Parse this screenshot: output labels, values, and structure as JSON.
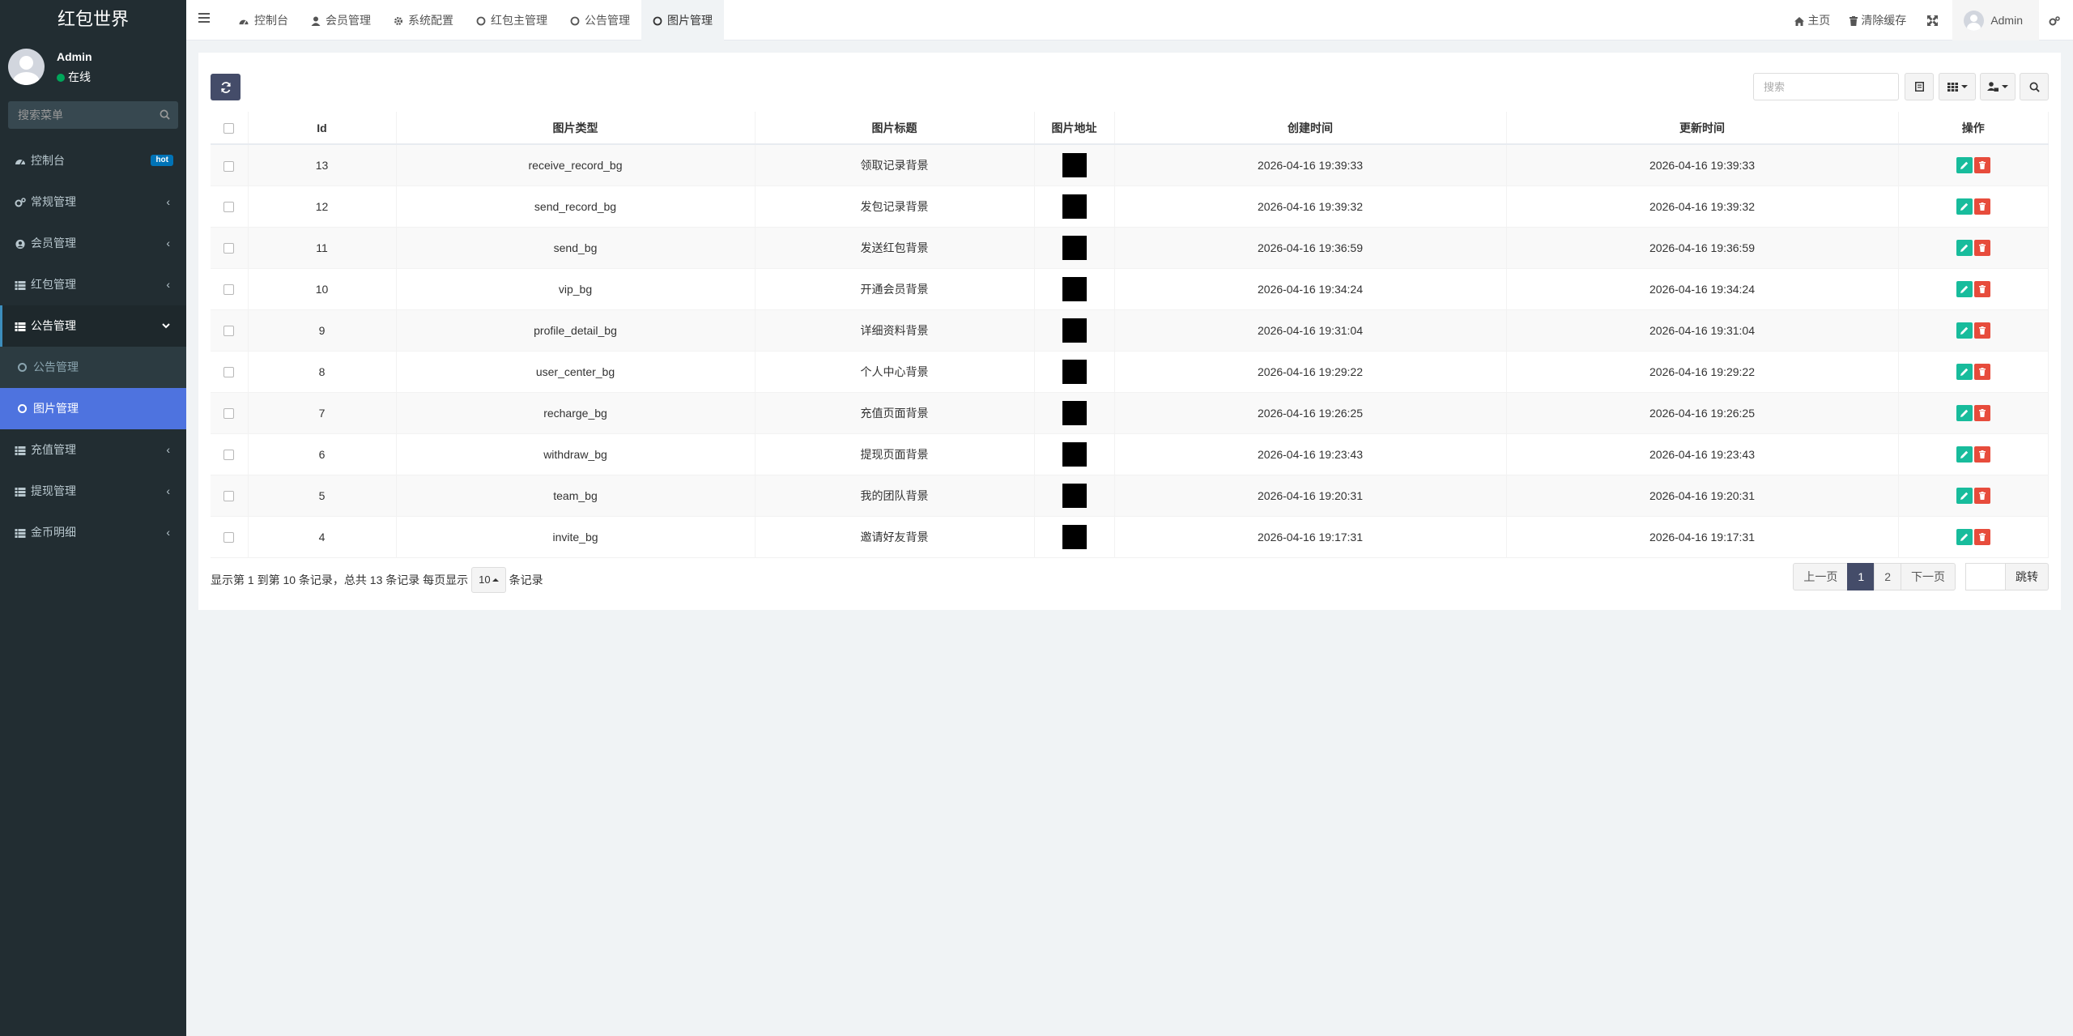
{
  "app": {
    "title": "红包世界"
  },
  "user": {
    "name": "Admin",
    "status": "在线"
  },
  "sidebar": {
    "search_placeholder": "搜索菜单",
    "items": [
      {
        "label": "控制台",
        "badge": "hot"
      },
      {
        "label": "常规管理"
      },
      {
        "label": "会员管理"
      },
      {
        "label": "红包管理"
      },
      {
        "label": "公告管理"
      },
      {
        "label": "公告管理"
      },
      {
        "label": "图片管理"
      },
      {
        "label": "充值管理"
      },
      {
        "label": "提现管理"
      },
      {
        "label": "金币明细"
      }
    ]
  },
  "header": {
    "tabs": [
      "控制台",
      "会员管理",
      "系统配置",
      "红包主管理",
      "公告管理",
      "图片管理"
    ],
    "home": "主页",
    "clear_cache": "清除缓存",
    "user": "Admin"
  },
  "toolbar": {
    "search_placeholder": "搜索"
  },
  "table": {
    "columns": [
      "Id",
      "图片类型",
      "图片标题",
      "图片地址",
      "创建时间",
      "更新时间",
      "操作"
    ],
    "rows": [
      {
        "id": "13",
        "type": "receive_record_bg",
        "title": "领取记录背景",
        "created": "2026-04-16 19:39:33",
        "updated": "2026-04-16 19:39:33"
      },
      {
        "id": "12",
        "type": "send_record_bg",
        "title": "发包记录背景",
        "created": "2026-04-16 19:39:32",
        "updated": "2026-04-16 19:39:32"
      },
      {
        "id": "11",
        "type": "send_bg",
        "title": "发送红包背景",
        "created": "2026-04-16 19:36:59",
        "updated": "2026-04-16 19:36:59"
      },
      {
        "id": "10",
        "type": "vip_bg",
        "title": "开通会员背景",
        "created": "2026-04-16 19:34:24",
        "updated": "2026-04-16 19:34:24"
      },
      {
        "id": "9",
        "type": "profile_detail_bg",
        "title": "详细资料背景",
        "created": "2026-04-16 19:31:04",
        "updated": "2026-04-16 19:31:04"
      },
      {
        "id": "8",
        "type": "user_center_bg",
        "title": "个人中心背景",
        "created": "2026-04-16 19:29:22",
        "updated": "2026-04-16 19:29:22"
      },
      {
        "id": "7",
        "type": "recharge_bg",
        "title": "充值页面背景",
        "created": "2026-04-16 19:26:25",
        "updated": "2026-04-16 19:26:25"
      },
      {
        "id": "6",
        "type": "withdraw_bg",
        "title": "提现页面背景",
        "created": "2026-04-16 19:23:43",
        "updated": "2026-04-16 19:23:43"
      },
      {
        "id": "5",
        "type": "team_bg",
        "title": "我的团队背景",
        "created": "2026-04-16 19:20:31",
        "updated": "2026-04-16 19:20:31"
      },
      {
        "id": "4",
        "type": "invite_bg",
        "title": "邀请好友背景",
        "created": "2026-04-16 19:17:31",
        "updated": "2026-04-16 19:17:31"
      }
    ]
  },
  "footer": {
    "summary_prefix": "显示第 1 到第 10 条记录，总共 13 条记录 每页显示",
    "page_size": "10",
    "summary_suffix": "条记录",
    "prev": "上一页",
    "pages": [
      "1",
      "2"
    ],
    "next": "下一页",
    "jump": "跳转"
  }
}
